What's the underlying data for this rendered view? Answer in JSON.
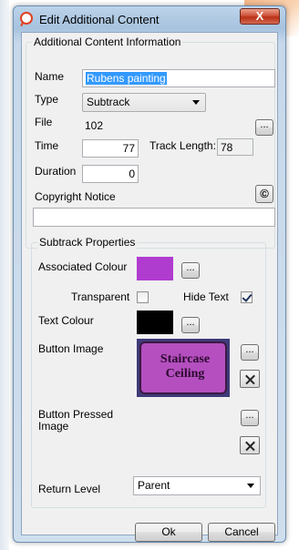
{
  "window": {
    "title": "Edit Additional Content",
    "close_label": "X"
  },
  "info_group": {
    "legend": "Additional Content Information",
    "name_label": "Name",
    "name_value": "Rubens painting",
    "type_label": "Type",
    "type_value": "Subtrack",
    "file_label": "File",
    "file_value": "102",
    "browse_label": "...",
    "time_label": "Time",
    "time_value": "77",
    "track_length_label": "Track Length:",
    "track_length_value": "78",
    "duration_label": "Duration",
    "duration_value": "0",
    "copyright_label": "Copyright Notice",
    "copyright_button_label": "©",
    "copyright_value": ""
  },
  "subtrack_group": {
    "legend": "Subtrack Properties",
    "assoc_colour_label": "Associated Colour",
    "assoc_colour": "#b03ccf",
    "assoc_browse_label": "...",
    "transparent_label": "Transparent",
    "transparent_checked": false,
    "hide_text_label": "Hide Text",
    "hide_text_checked": true,
    "text_colour_label": "Text Colour",
    "text_colour": "#000000",
    "text_browse_label": "...",
    "button_image_label": "Button Image",
    "button_image_text_line1": "Staircase",
    "button_image_text_line2": "Ceiling",
    "button_image_browse_label": "...",
    "pressed_image_label_line1": "Button Pressed",
    "pressed_image_label_line2": "Image",
    "pressed_image_browse_label": "...",
    "return_level_label": "Return Level",
    "return_level_value": "Parent"
  },
  "footer": {
    "ok_label": "Ok",
    "cancel_label": "Cancel"
  },
  "icons": {
    "app": "speech-bubble-icon",
    "clear": "x-icon",
    "dropdown": "chevron-down-icon"
  }
}
